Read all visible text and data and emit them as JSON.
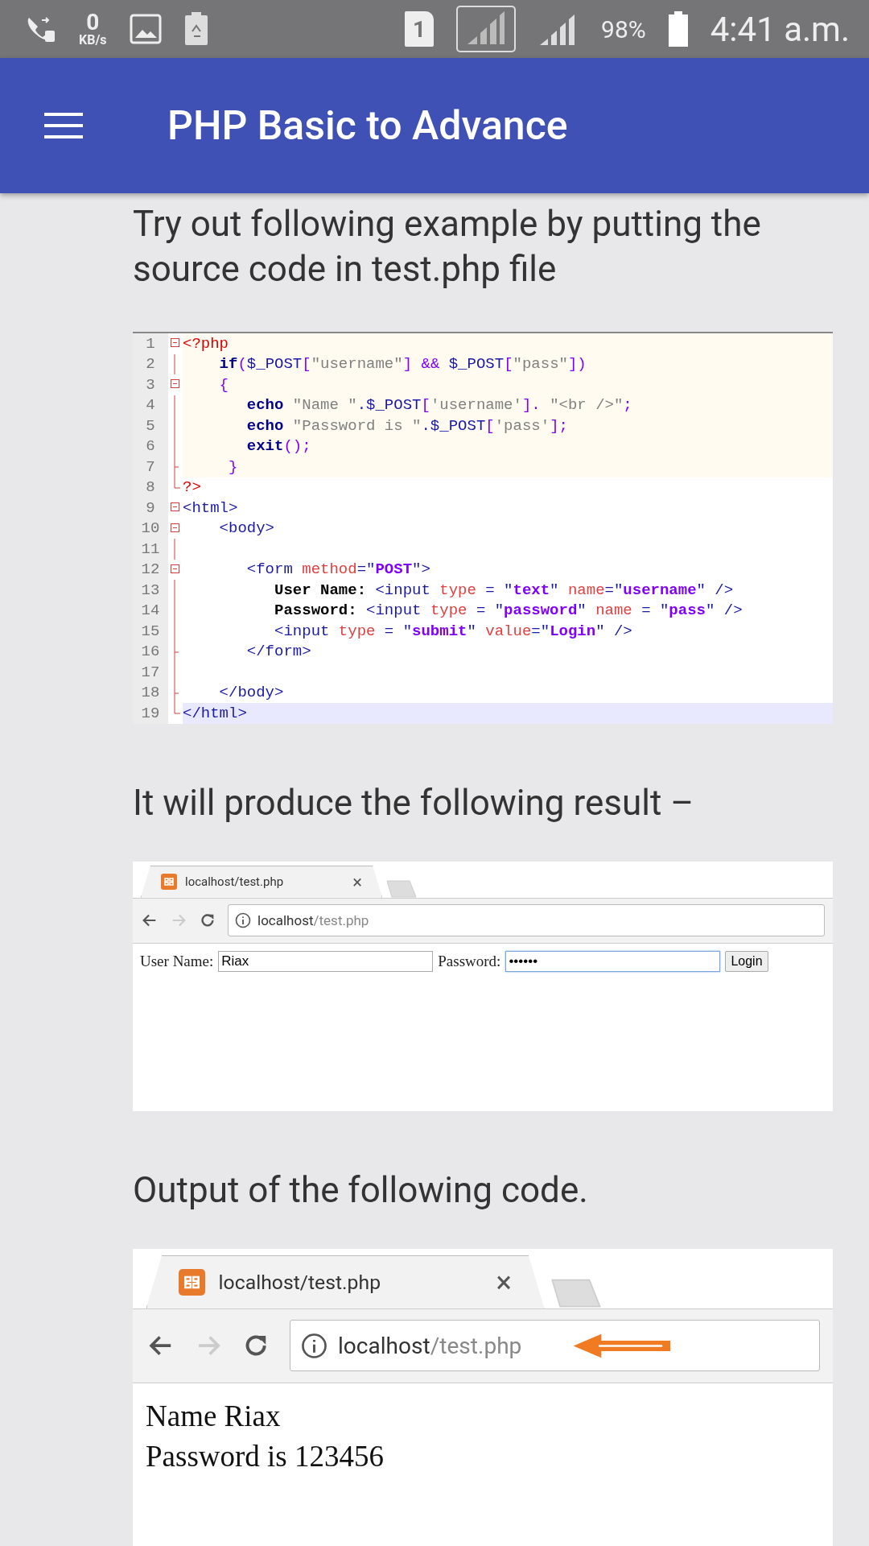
{
  "status_bar": {
    "net_speed": "0",
    "net_unit": "KB/s",
    "sim": "1",
    "battery": "98%",
    "time": "4:41 a.m."
  },
  "app_bar": {
    "title": "PHP Basic to Advance"
  },
  "intro": "Try out following example by putting the source code in test.php file",
  "code": [
    {
      "number": "1",
      "kind": "open",
      "php": true,
      "selected": false,
      "parts": [
        {
          "kind": "php",
          "text": "<?php"
        }
      ]
    },
    {
      "number": "2",
      "kind": "line",
      "php": true,
      "selected": false,
      "parts": [
        {
          "kind": "kw",
          "text": "    if"
        },
        {
          "kind": "op",
          "text": "("
        },
        {
          "kind": "plain",
          "text": "$_POST"
        },
        {
          "kind": "op",
          "text": "["
        },
        {
          "kind": "str",
          "text": "\"username\""
        },
        {
          "kind": "op",
          "text": "] && "
        },
        {
          "kind": "plain",
          "text": "$_POST"
        },
        {
          "kind": "op",
          "text": "["
        },
        {
          "kind": "str",
          "text": "\"pass\""
        },
        {
          "kind": "op",
          "text": "])"
        }
      ]
    },
    {
      "number": "3",
      "kind": "open",
      "php": true,
      "selected": false,
      "parts": [
        {
          "kind": "op",
          "text": "    {"
        }
      ]
    },
    {
      "number": "4",
      "kind": "line",
      "php": true,
      "selected": false,
      "parts": [
        {
          "kind": "kw",
          "text": "       echo "
        },
        {
          "kind": "str",
          "text": "\"Name \""
        },
        {
          "kind": "plain",
          "text": ".$_POST"
        },
        {
          "kind": "op",
          "text": "["
        },
        {
          "kind": "str",
          "text": "'username'"
        },
        {
          "kind": "op",
          "text": "]. "
        },
        {
          "kind": "str",
          "text": "\"<br />\""
        },
        {
          "kind": "op",
          "text": ";"
        }
      ]
    },
    {
      "number": "5",
      "kind": "line",
      "php": true,
      "selected": false,
      "parts": [
        {
          "kind": "kw",
          "text": "       echo "
        },
        {
          "kind": "str",
          "text": "\"Password is \""
        },
        {
          "kind": "plain",
          "text": ".$_POST"
        },
        {
          "kind": "op",
          "text": "["
        },
        {
          "kind": "str",
          "text": "'pass'"
        },
        {
          "kind": "op",
          "text": "];"
        }
      ]
    },
    {
      "number": "6",
      "kind": "line",
      "php": true,
      "selected": false,
      "parts": [
        {
          "kind": "kw",
          "text": "       exit"
        },
        {
          "kind": "op",
          "text": "();"
        }
      ]
    },
    {
      "number": "7",
      "kind": "tick",
      "php": true,
      "selected": false,
      "parts": [
        {
          "kind": "op",
          "text": "     }"
        }
      ]
    },
    {
      "number": "8",
      "kind": "end",
      "php": false,
      "selected": false,
      "parts": [
        {
          "kind": "php",
          "text": "?>"
        }
      ]
    },
    {
      "number": "9",
      "kind": "open",
      "php": false,
      "selected": false,
      "parts": [
        {
          "kind": "tag",
          "text": "<html>"
        }
      ]
    },
    {
      "number": "10",
      "kind": "open",
      "php": false,
      "selected": false,
      "parts": [
        {
          "kind": "tag",
          "text": "    <body>"
        }
      ]
    },
    {
      "number": "11",
      "kind": "line"
    },
    {
      "number": "12",
      "kind": "open",
      "php": false,
      "selected": false,
      "parts": [
        {
          "kind": "tag",
          "text": "       <form "
        },
        {
          "kind": "attr",
          "text": "method"
        },
        {
          "kind": "tag",
          "text": "=\""
        },
        {
          "kind": "val",
          "text": "POST"
        },
        {
          "kind": "tag",
          "text": "\">"
        }
      ]
    },
    {
      "number": "13",
      "kind": "line",
      "php": false,
      "selected": false,
      "parts": [
        {
          "kind": "text",
          "text": "          User Name: "
        },
        {
          "kind": "tag",
          "text": "<input "
        },
        {
          "kind": "attr",
          "text": "type"
        },
        {
          "kind": "tag",
          "text": " = \""
        },
        {
          "kind": "val",
          "text": "text"
        },
        {
          "kind": "tag",
          "text": "\" "
        },
        {
          "kind": "attr",
          "text": "name"
        },
        {
          "kind": "tag",
          "text": "=\""
        },
        {
          "kind": "val",
          "text": "username"
        },
        {
          "kind": "tag",
          "text": "\" />"
        }
      ]
    },
    {
      "number": "14",
      "kind": "line",
      "php": false,
      "selected": false,
      "parts": [
        {
          "kind": "text",
          "text": "          Password: "
        },
        {
          "kind": "tag",
          "text": "<input "
        },
        {
          "kind": "attr",
          "text": "type"
        },
        {
          "kind": "tag",
          "text": " = \""
        },
        {
          "kind": "val",
          "text": "password"
        },
        {
          "kind": "tag",
          "text": "\" "
        },
        {
          "kind": "attr",
          "text": "name"
        },
        {
          "kind": "tag",
          "text": " = \""
        },
        {
          "kind": "val",
          "text": "pass"
        },
        {
          "kind": "tag",
          "text": "\" />"
        }
      ]
    },
    {
      "number": "15",
      "kind": "line",
      "php": false,
      "selected": false,
      "parts": [
        {
          "kind": "tag",
          "text": "          <input "
        },
        {
          "kind": "attr",
          "text": "type"
        },
        {
          "kind": "tag",
          "text": " = \""
        },
        {
          "kind": "val",
          "text": "submit"
        },
        {
          "kind": "tag",
          "text": "\" "
        },
        {
          "kind": "attr",
          "text": "value"
        },
        {
          "kind": "tag",
          "text": "=\""
        },
        {
          "kind": "val",
          "text": "Login"
        },
        {
          "kind": "tag",
          "text": "\" />"
        }
      ]
    },
    {
      "number": "16",
      "kind": "tick",
      "php": false,
      "selected": false,
      "parts": [
        {
          "kind": "tag",
          "text": "       </form>"
        }
      ]
    },
    {
      "number": "17",
      "kind": "line"
    },
    {
      "number": "18",
      "kind": "tick",
      "php": false,
      "selected": false,
      "parts": [
        {
          "kind": "tag",
          "text": "    </body>"
        }
      ]
    },
    {
      "number": "19",
      "kind": "end",
      "php": false,
      "selected": true,
      "parts": [
        {
          "kind": "tag",
          "text": "</html>"
        }
      ]
    }
  ],
  "result_heading": "It will produce the following result –",
  "output_heading": "Output of the following code.",
  "browsers": [
    {
      "kind": "form",
      "tab_title": "localhost/test.php",
      "tab_close": "×",
      "url_host": "localhost",
      "url_path": "/test.php",
      "fields": [
        {
          "label": "User Name:",
          "value": "Riax",
          "focused": false
        },
        {
          "label": "Password:",
          "value": "••••••",
          "focused": true
        }
      ],
      "submit": "Login"
    },
    {
      "kind": "output",
      "tab_title": "localhost/test.php",
      "tab_close": "×",
      "url_host": "localhost",
      "url_path": "/test.php",
      "url_arrow": true,
      "lines": [
        "Name Riax",
        "Password is 123456"
      ]
    }
  ]
}
